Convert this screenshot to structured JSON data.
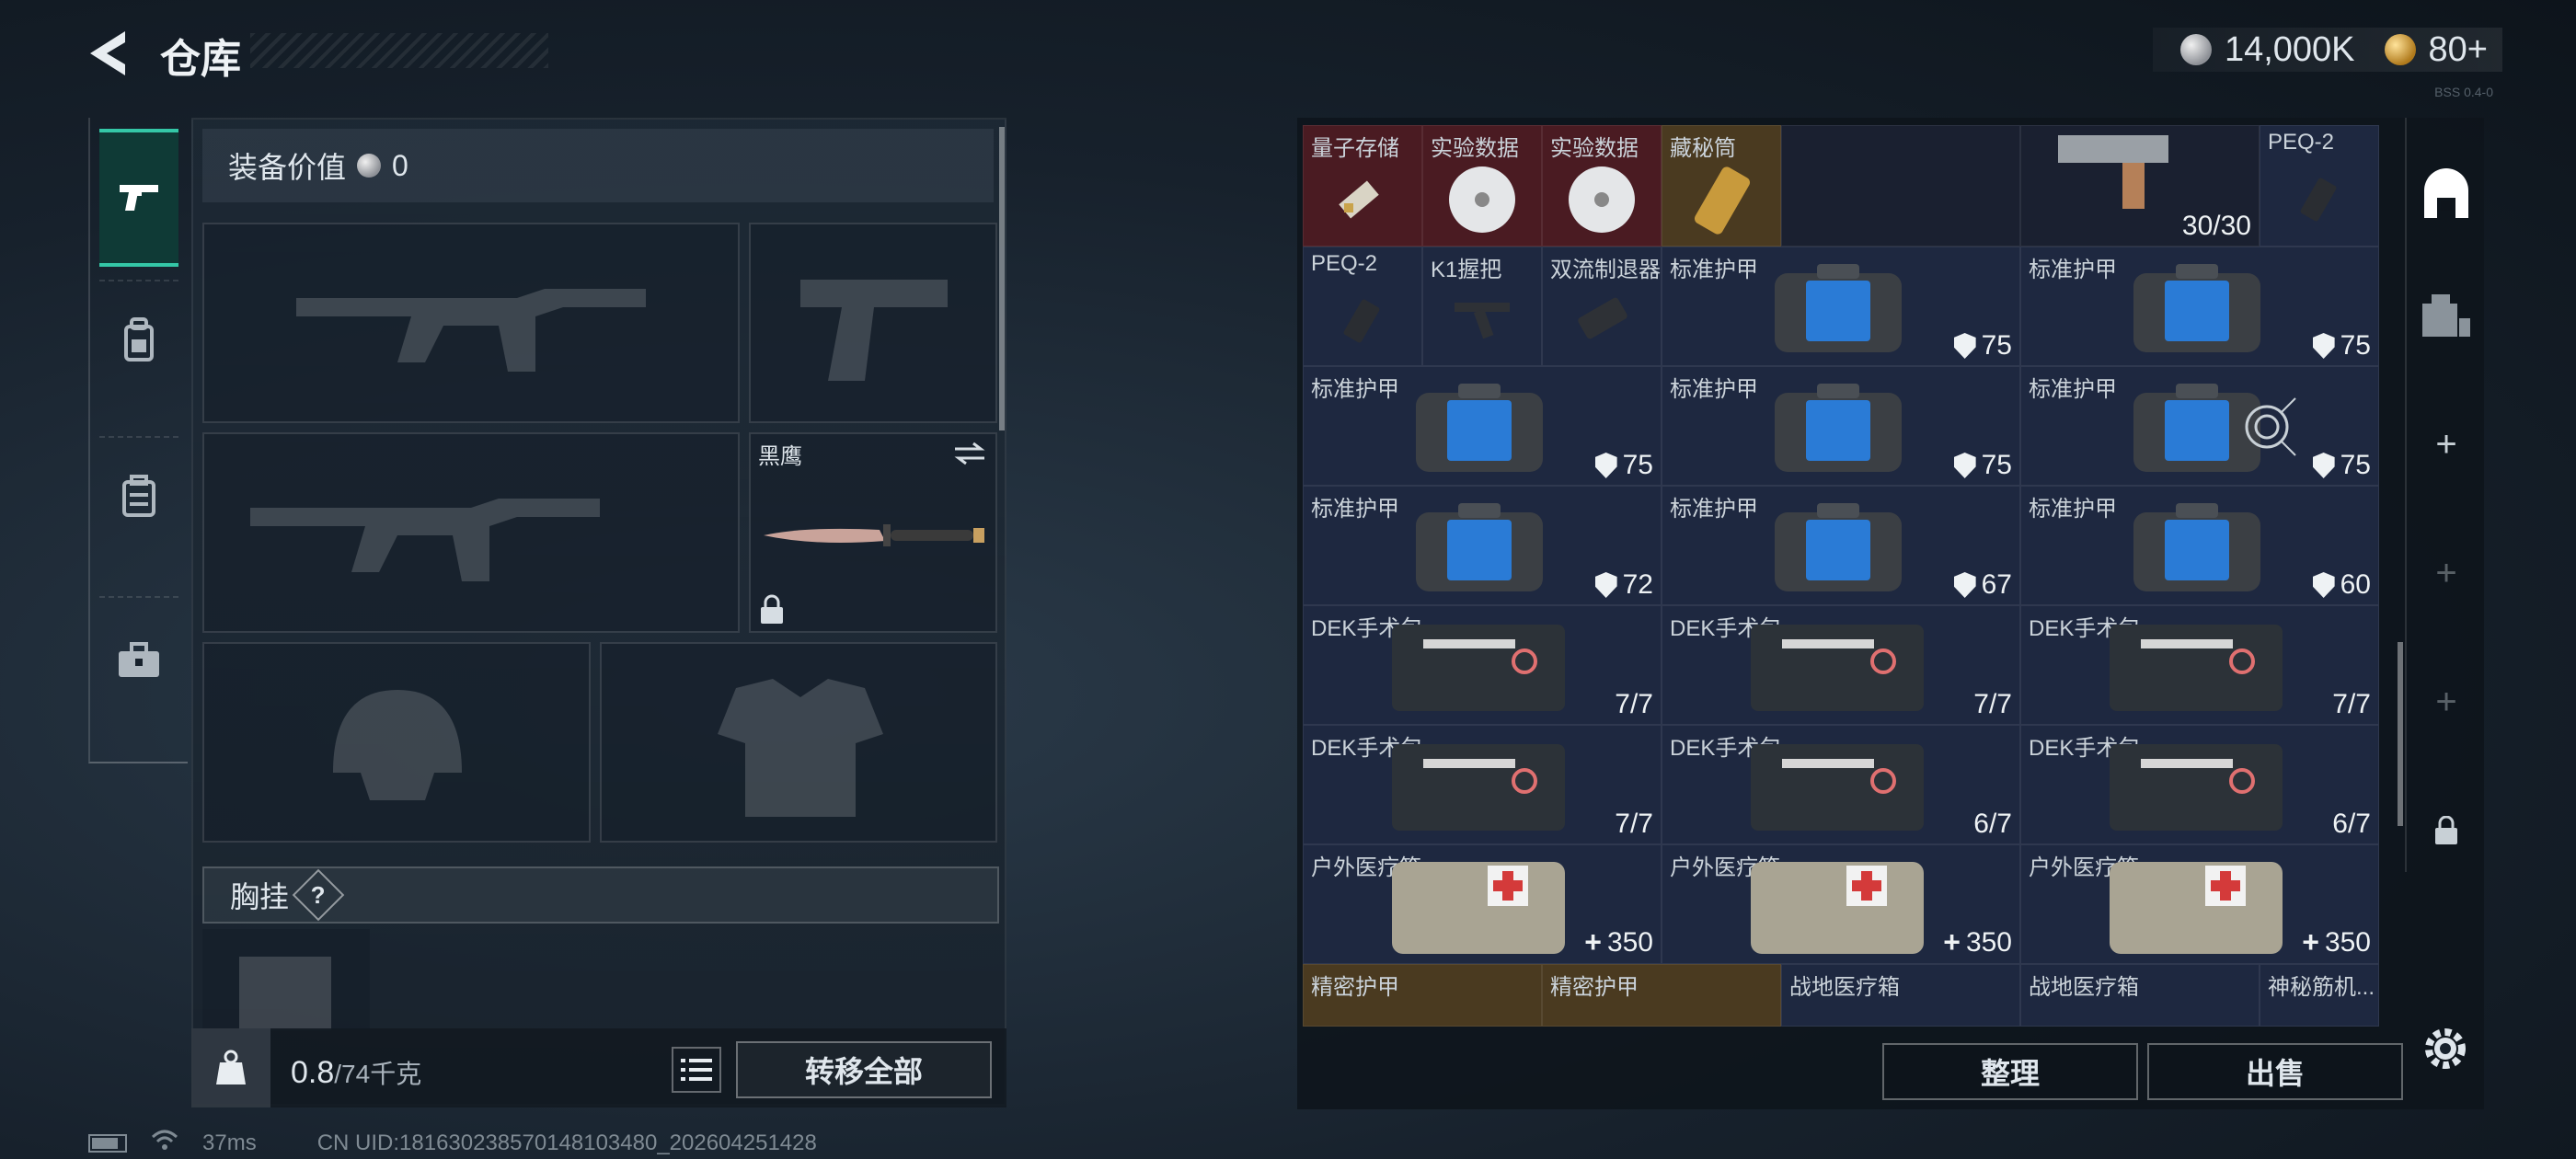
{
  "header": {
    "title": "仓库",
    "currency_silver": "14,000K",
    "currency_gold": "80+",
    "version": "BSS 0.4-0"
  },
  "left": {
    "equip_value_label": "装备价值",
    "equip_value": "0",
    "knife_name": "黑鹰",
    "rig_label": "胸挂",
    "help": "?",
    "weight_value": "0.8",
    "weight_max": "/74千克",
    "transfer_all": "转移全部"
  },
  "grid": {
    "row0": [
      {
        "name": "量子存储"
      },
      {
        "name": "实验数据"
      },
      {
        "name": "实验数据"
      },
      {
        "name": "藏秘筒"
      },
      {
        "count": "30/30"
      },
      {
        "name": "PEQ-2"
      }
    ],
    "row1": [
      {
        "name": "PEQ-2"
      },
      {
        "name": "K1握把"
      },
      {
        "name": "双流制退器"
      },
      {
        "name": "标准护甲",
        "count": "75"
      },
      {
        "name": "标准护甲",
        "count": "75"
      }
    ],
    "row2": [
      {
        "name": "标准护甲",
        "count": "75"
      },
      {
        "name": "标准护甲",
        "count": "75"
      },
      {
        "name": "标准护甲",
        "count": "75"
      }
    ],
    "row3": [
      {
        "name": "标准护甲",
        "count": "72"
      },
      {
        "name": "标准护甲",
        "count": "67"
      },
      {
        "name": "标准护甲",
        "count": "60"
      }
    ],
    "row4": [
      {
        "name": "DEK手术包",
        "count": "7/7"
      },
      {
        "name": "DEK手术包",
        "count": "7/7"
      },
      {
        "name": "DEK手术包",
        "count": "7/7"
      }
    ],
    "row5": [
      {
        "name": "DEK手术包",
        "count": "7/7"
      },
      {
        "name": "DEK手术包",
        "count": "6/7"
      },
      {
        "name": "DEK手术包",
        "count": "6/7"
      }
    ],
    "row6": [
      {
        "name": "户外医疗箱",
        "count": "350"
      },
      {
        "name": "户外医疗箱",
        "count": "350"
      },
      {
        "name": "户外医疗箱",
        "count": "350"
      }
    ],
    "row7": [
      {
        "name": "精密护甲"
      },
      {
        "name": "精密护甲"
      },
      {
        "name": "战地医疗箱"
      },
      {
        "name": "战地医疗箱"
      },
      {
        "name": "神秘筋机..."
      }
    ]
  },
  "right": {
    "sort": "整理",
    "sell": "出售"
  },
  "status": {
    "ping": "37ms",
    "uid": "CN UID:181630238570148103480_202604251428"
  },
  "colors": {
    "accent": "#34c7a7",
    "cell_blue": "#1e2840",
    "cell_red": "#4a1b22",
    "cell_gold": "#4a3a20"
  }
}
